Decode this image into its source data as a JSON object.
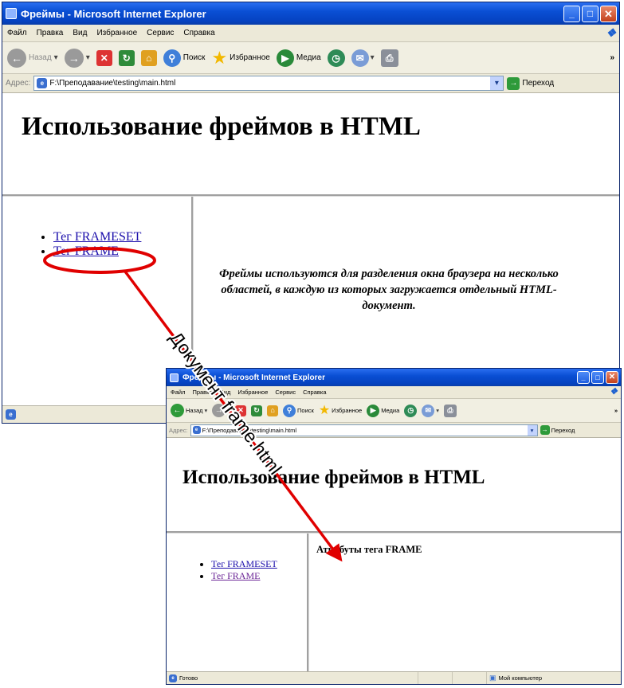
{
  "browser1": {
    "title": "Фреймы - Microsoft Internet Explorer",
    "menu": [
      "Файл",
      "Правка",
      "Вид",
      "Избранное",
      "Сервис",
      "Справка"
    ],
    "toolbar": {
      "back_label": "Назад",
      "search_label": "Поиск",
      "favorites_label": "Избранное",
      "media_label": "Медиа"
    },
    "address": {
      "label": "Адрес:",
      "value": "F:\\Преподавание\\testing\\main.html",
      "go_label": "Переход"
    },
    "page": {
      "heading": "Использование фреймов в HTML",
      "links": [
        "Тег FRAMESET",
        "Тег FRAME"
      ],
      "description": "Фреймы используются для разделения окна браузера на несколько областей, в каждую из которых загружается отдельный HTML-документ."
    }
  },
  "browser2": {
    "title": "Фреймы - Microsoft Internet Explorer",
    "menu": [
      "Файл",
      "Правка",
      "Вид",
      "Избранное",
      "Сервис",
      "Справка"
    ],
    "toolbar": {
      "back_label": "Назад",
      "search_label": "Поиск",
      "favorites_label": "Избранное",
      "media_label": "Медиа"
    },
    "address": {
      "label": "Адрес:",
      "value": "F:\\Преподавание\\testing\\main.html",
      "go_label": "Переход"
    },
    "page": {
      "heading": "Использование фреймов в HTML",
      "links": [
        "Тег FRAMESET",
        "Тег FRAME"
      ],
      "frame_heading": "Атрибуты тега FRAME"
    },
    "status": {
      "text": "Готово",
      "zone": "Мой компьютер"
    }
  },
  "annotation": {
    "label": "Документ frame.html",
    "color": "#e00000"
  },
  "colors": {
    "titlebar": "#0a4fd4",
    "chrome": "#ece9d8",
    "link": "#1a0dab",
    "visited_link": "#6b2596"
  }
}
